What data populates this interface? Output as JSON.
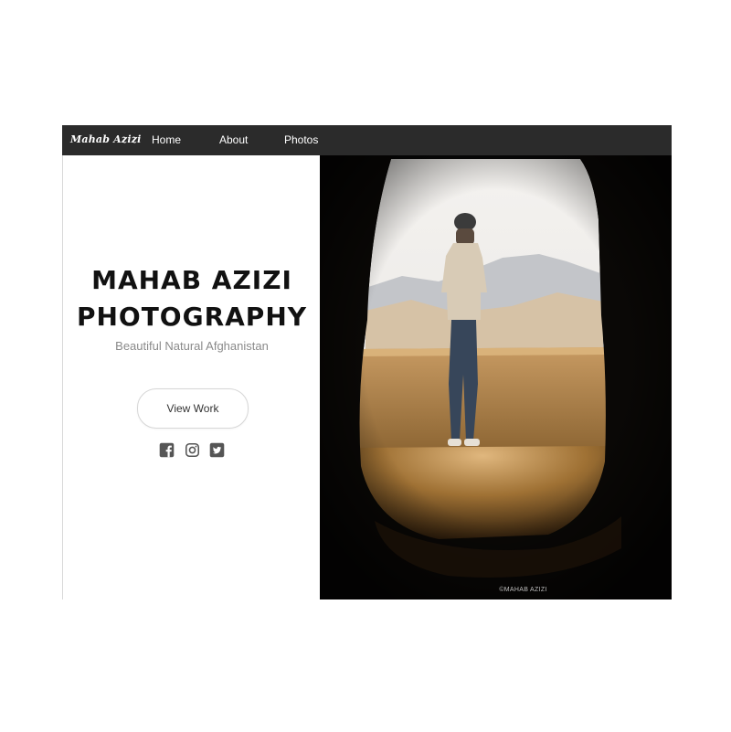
{
  "nav": {
    "brand": "Mahab Azizi",
    "links": [
      "Home",
      "About",
      "Photos"
    ]
  },
  "hero": {
    "title_line1": "MAHAB AZIZI",
    "title_line2": "PHOTOGRAPHY",
    "subtitle": "Beautiful Natural Afghanistan",
    "cta_label": "View Work",
    "social_icons": [
      "facebook-icon",
      "instagram-icon",
      "twitter-icon"
    ]
  },
  "photo": {
    "watermark": "©MAHAB AZIZI"
  },
  "colors": {
    "navbar": "#2b2b2b",
    "title": "#111111",
    "subtitle": "#8a8a8a",
    "icons": "#555555"
  }
}
